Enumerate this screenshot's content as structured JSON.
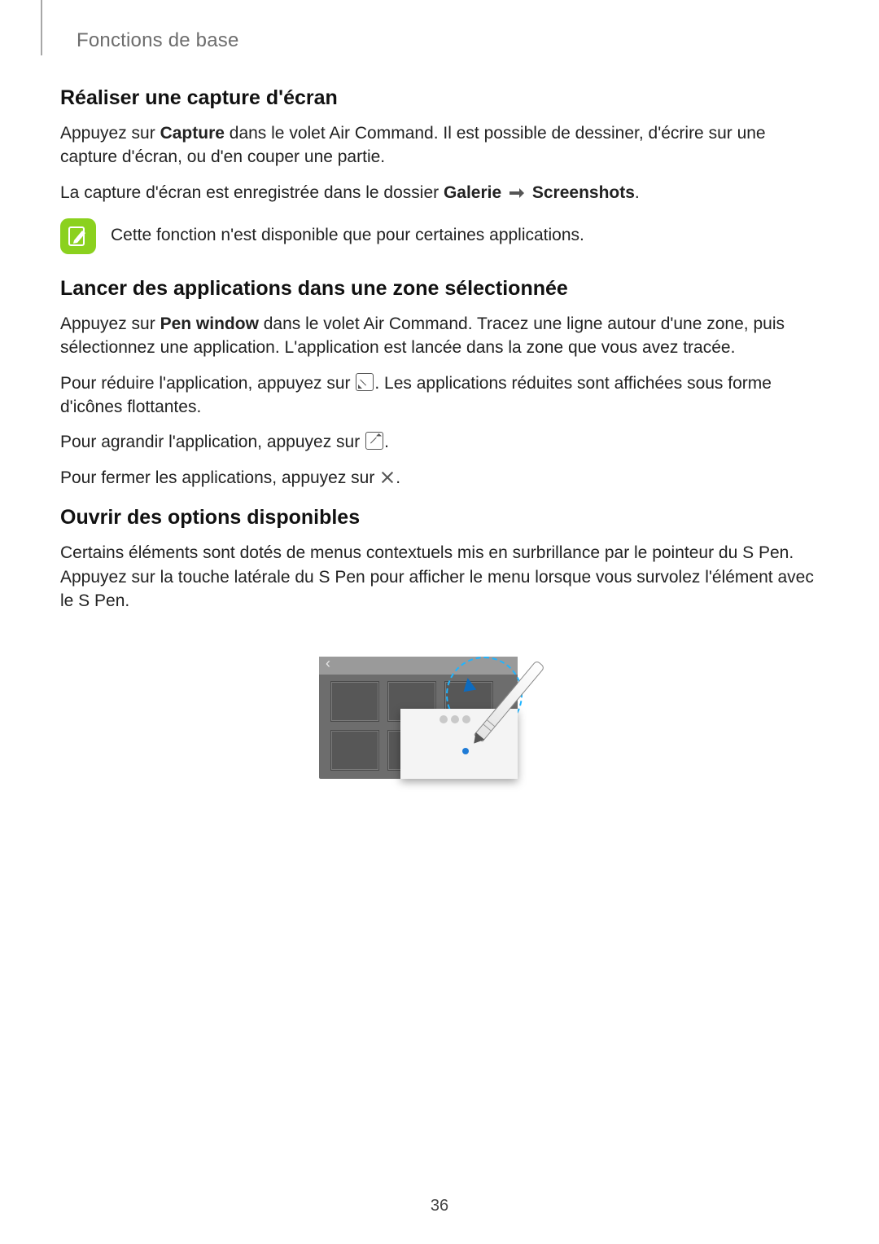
{
  "header": {
    "section": "Fonctions de base"
  },
  "sec1": {
    "title": "Réaliser une capture d'écran",
    "p1a": "Appuyez sur ",
    "p1b": "Capture",
    "p1c": " dans le volet Air Command. Il est possible de dessiner, d'écrire sur une capture d'écran, ou d'en couper une partie.",
    "p2a": "La capture d'écran est enregistrée dans le dossier ",
    "p2b": "Galerie",
    "p2c": "Screenshots",
    "p2d": ".",
    "callout": "Cette fonction n'est disponible que pour certaines applications."
  },
  "sec2": {
    "title": "Lancer des applications dans une zone sélectionnée",
    "p1a": "Appuyez sur ",
    "p1b": "Pen window",
    "p1c": " dans le volet Air Command. Tracez une ligne autour d'une zone, puis sélectionnez une application. L'application est lancée dans la zone que vous avez tracée.",
    "p2a": "Pour réduire l'application, appuyez sur ",
    "p2b": ". Les applications réduites sont affichées sous forme d'icônes flottantes.",
    "p3a": "Pour agrandir l'application, appuyez sur ",
    "p3b": ".",
    "p4a": "Pour fermer les applications, appuyez sur ",
    "p4b": "."
  },
  "sec3": {
    "title": "Ouvrir des options disponibles",
    "p1": "Certains éléments sont dotés de menus contextuels mis en surbrillance par le pointeur du S Pen. Appuyez sur la touche latérale du S Pen pour afficher le menu lorsque vous survolez l'élément avec le S Pen."
  },
  "page_number": "36"
}
